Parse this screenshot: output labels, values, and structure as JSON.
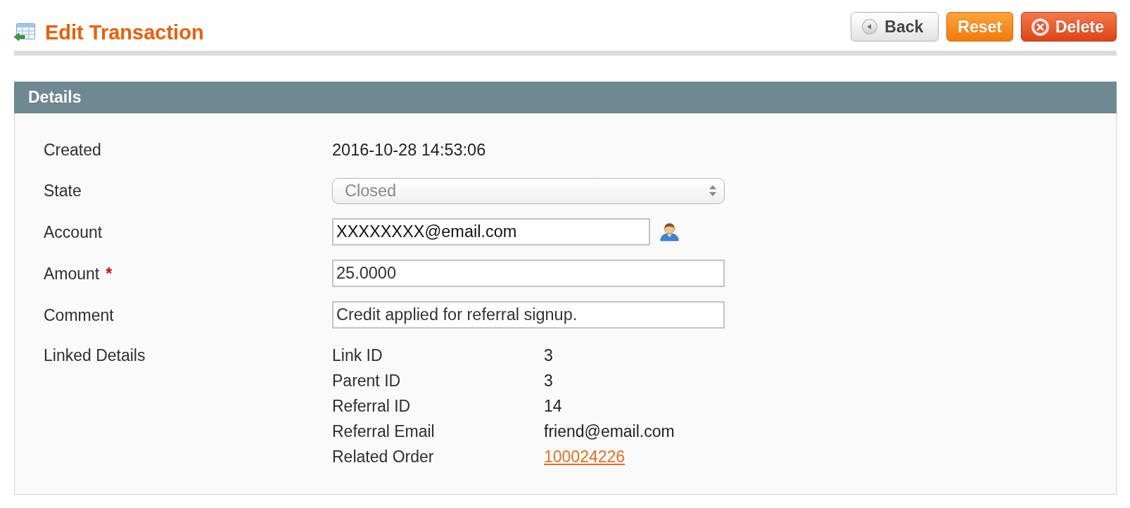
{
  "page": {
    "title": "Edit Transaction"
  },
  "actions": [
    {
      "kind": "back",
      "label": "Back"
    },
    {
      "kind": "reset",
      "label": "Reset"
    },
    {
      "kind": "delete",
      "label": "Delete"
    }
  ],
  "details": {
    "title": "Details",
    "fields": [
      {
        "kind": "text",
        "label": "Created",
        "value": "2016-10-28 14:53:06"
      },
      {
        "kind": "select",
        "label": "State",
        "value": "Closed",
        "disabled": true
      },
      {
        "kind": "lookup",
        "label": "Account",
        "value": "XXXXXXXX@email.com"
      },
      {
        "kind": "input",
        "label": "Amount",
        "required_mark": "*",
        "value": "25.0000"
      },
      {
        "kind": "input",
        "label": "Comment",
        "value": "Credit applied for referral signup."
      },
      {
        "kind": "linked",
        "label": "Linked Details",
        "items": [
          {
            "kind": "text",
            "label": "Link ID",
            "value": "3"
          },
          {
            "kind": "text",
            "label": "Parent ID",
            "value": "3"
          },
          {
            "kind": "text",
            "label": "Referral ID",
            "value": "14"
          },
          {
            "kind": "text",
            "label": "Referral Email",
            "value": "friend@email.com"
          },
          {
            "kind": "link",
            "label": "Related Order",
            "value": "100024226"
          }
        ]
      }
    ]
  }
}
